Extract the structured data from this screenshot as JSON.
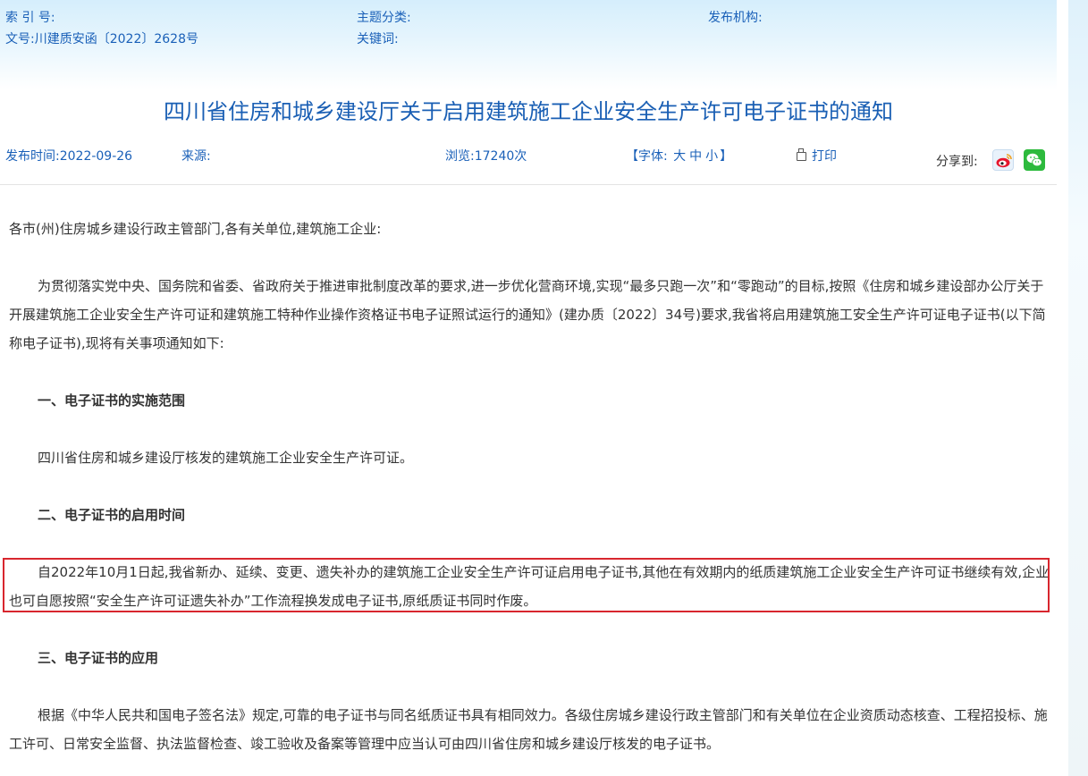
{
  "meta": {
    "index_label": "索 引 号:",
    "index_value": "",
    "topic_label": "主题分类:",
    "topic_value": "",
    "issuer_label": "发布机构:",
    "issuer_value": "",
    "docno_label": "文号:",
    "docno_value": "川建质安函〔2022〕2628号",
    "keywords_label": "关键词:",
    "keywords_value": ""
  },
  "article": {
    "title": "四川省住房和城乡建设厅关于启用建筑施工企业安全生产许可电子证书的通知",
    "publish_time": "发布时间:2022-09-26",
    "source": "来源:",
    "views": "浏览:17240次",
    "font_prefix": "【字体:",
    "font_large": "大",
    "font_medium": "中",
    "font_small": "小",
    "font_suffix": "】",
    "print_label": "打印",
    "share_label": "分享到:",
    "share_icons": [
      "weibo-icon",
      "wechat-icon"
    ]
  },
  "body": {
    "salutation": "各市(州)住房城乡建设行政主管部门,各有关单位,建筑施工企业:",
    "intro": "为贯彻落实党中央、国务院和省委、省政府关于推进审批制度改革的要求,进一步优化营商环境,实现“最多只跑一次”和“零跑动”的目标,按照《住房和城乡建设部办公厅关于开展建筑施工企业安全生产许可证和建筑施工特种作业操作资格证书电子证照试运行的通知》(建办质〔2022〕34号)要求,我省将启用建筑施工安全生产许可证电子证书(以下简称电子证书),现将有关事项通知如下:",
    "section1_heading": "一、电子证书的实施范围",
    "section1_text": "四川省住房和城乡建设厅核发的建筑施工企业安全生产许可证。",
    "section2_heading": "二、电子证书的启用时间",
    "section2_text": "自2022年10月1日起,我省新办、延续、变更、遗失补办的建筑施工企业安全生产许可证启用电子证书,其他在有效期内的纸质建筑施工企业安全生产许可证书继续有效,企业也可自愿按照“安全生产许可证遗失补办”工作流程换发成电子证书,原纸质证书同时作废。",
    "section3_heading": "三、电子证书的应用",
    "section3_text": "根据《中华人民共和国电子签名法》规定,可靠的电子证书与同名纸质证书具有相同效力。各级住房城乡建设行政主管部门和有关单位在企业资质动态核查、工程招投标、施工许可、日常安全监督、执法监督检查、竣工验收及备案等管理中应当认可由四川省住房和城乡建设厅核发的电子证书。"
  },
  "colors": {
    "link_blue": "#1a60b8",
    "title_blue": "#1a5fb4",
    "highlight_red": "#d8262e",
    "wechat_green": "#2dba3d",
    "weibo_red": "#e6162d"
  }
}
